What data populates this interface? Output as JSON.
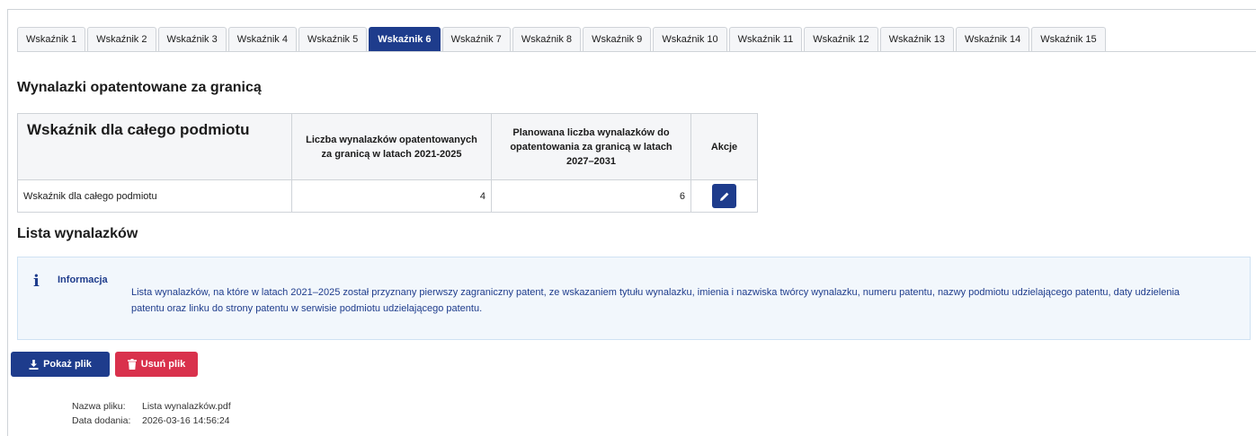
{
  "tabs": [
    {
      "label": "Wskaźnik 1",
      "active": false
    },
    {
      "label": "Wskaźnik 2",
      "active": false
    },
    {
      "label": "Wskaźnik 3",
      "active": false
    },
    {
      "label": "Wskaźnik 4",
      "active": false
    },
    {
      "label": "Wskaźnik 5",
      "active": false
    },
    {
      "label": "Wskaźnik 6",
      "active": true
    },
    {
      "label": "Wskaźnik 7",
      "active": false
    },
    {
      "label": "Wskaźnik 8",
      "active": false
    },
    {
      "label": "Wskaźnik 9",
      "active": false
    },
    {
      "label": "Wskaźnik 10",
      "active": false
    },
    {
      "label": "Wskaźnik 11",
      "active": false
    },
    {
      "label": "Wskaźnik 12",
      "active": false
    },
    {
      "label": "Wskaźnik 13",
      "active": false
    },
    {
      "label": "Wskaźnik 14",
      "active": false
    },
    {
      "label": "Wskaźnik 15",
      "active": false
    }
  ],
  "section1": {
    "title": "Wynalazki opatentowane za granicą"
  },
  "table": {
    "headers": {
      "entity": "Wskaźnik dla całego podmiotu",
      "col1": "Liczba wynalazków opatentowanych za granicą w latach 2021-2025",
      "col2": "Planowana liczba wynalazków do opatentowania za granicą w latach 2027–2031",
      "actions": "Akcje"
    },
    "rows": [
      {
        "name": "Wskaźnik dla całego podmiotu",
        "value1": "4",
        "value2": "6",
        "action_icon": "pencil-icon"
      }
    ]
  },
  "section2": {
    "title": "Lista wynalazków"
  },
  "info": {
    "icon": "i",
    "label": "Informacja",
    "text": "Lista wynalazków, na które w latach 2021–2025 został przyznany pierwszy zagraniczny patent, ze wskazaniem tytułu wynalazku, imienia i nazwiska twórcy wynalazku, numeru patentu, nazwy podmiotu udzielającego patentu, daty udzielenia patentu oraz linku do strony patentu w serwisie podmiotu udzielającego patentu."
  },
  "buttons": {
    "show_file": "Pokaż plik",
    "delete_file": "Usuń plik"
  },
  "file": {
    "name_label": "Nazwa pliku:",
    "name_value": "Lista wynalazków.pdf",
    "date_label": "Data dodania:",
    "date_value": "2026-03-16 14:56:24"
  },
  "colors": {
    "primary": "#1e3c8c",
    "danger": "#d9314c",
    "info_bg": "#f2f7fc"
  }
}
